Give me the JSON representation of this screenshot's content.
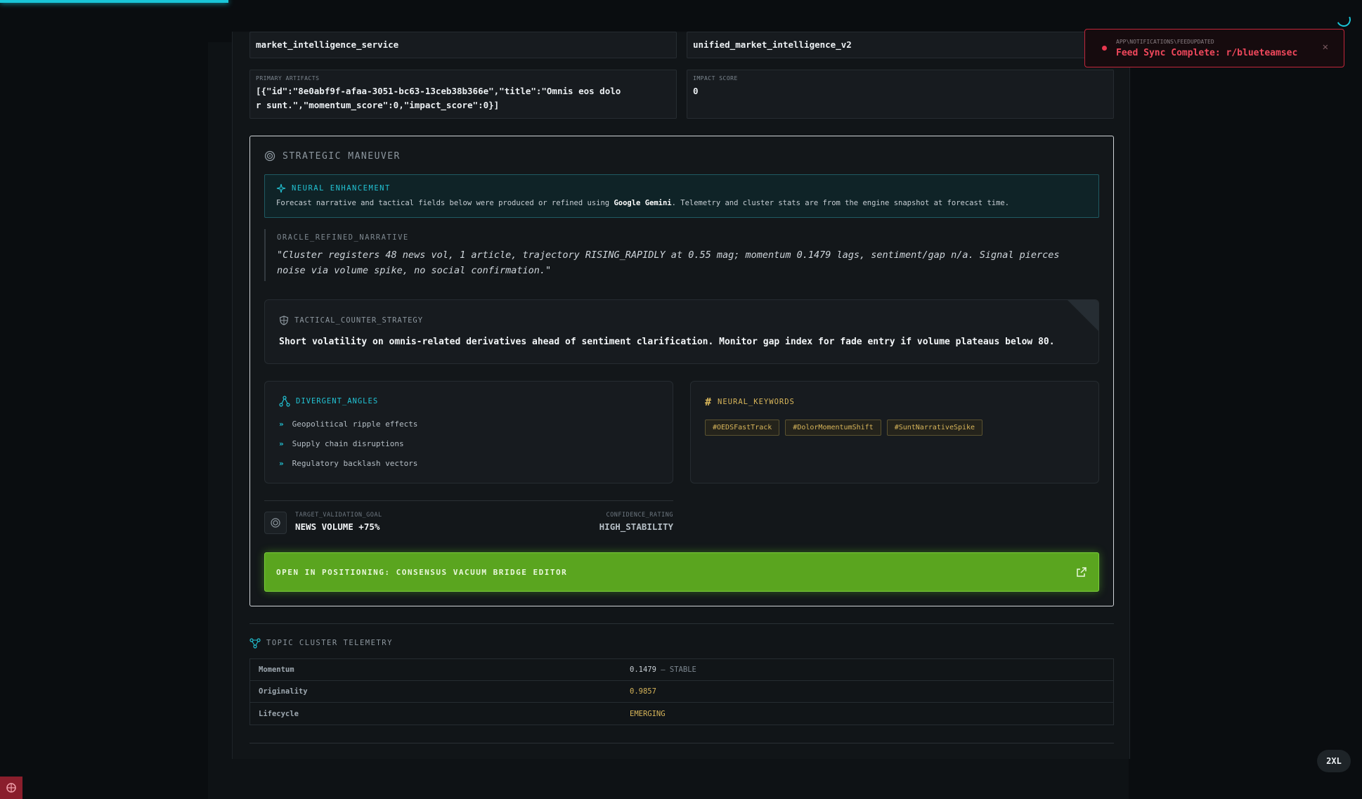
{
  "meta_fields": {
    "service": "market_intelligence_service",
    "model": "unified_market_intelligence_v2",
    "primary_artifacts_label": "PRIMARY ARTIFACTS",
    "primary_artifacts_value": "[{\"id\":\"8e0abf9f-afaa-3051-bc63-13ceb38b366e\",\"title\":\"Omnis eos dolor sunt.\",\"momentum_score\":0,\"impact_score\":0}]",
    "impact_score_label": "IMPACT SCORE",
    "impact_score_value": "0"
  },
  "strategic": {
    "title": "STRATEGIC MANEUVER",
    "neural": {
      "title": "NEURAL ENHANCEMENT",
      "text_before": "Forecast narrative and tactical fields below were produced or refined using ",
      "text_bold": "Google Gemini",
      "text_after": ". Telemetry and cluster stats are from the engine snapshot at forecast time."
    },
    "oracle_label": "ORACLE_REFINED_NARRATIVE",
    "oracle_text": "\"Cluster registers 48 news vol, 1 article, trajectory RISING_RAPIDLY at 0.55 mag; momentum 0.1479 lags, sentiment/gap n/a. Signal pierces noise via volume spike, no social confirmation.\"",
    "tactical_label": "TACTICAL_COUNTER_STRATEGY",
    "tactical_text": "Short volatility on omnis-related derivatives ahead of sentiment clarification. Monitor gap index for fade entry if volume plateaus below 80.",
    "angles_title": "DIVERGENT_ANGLES",
    "angles": [
      "Geopolitical ripple effects",
      "Supply chain disruptions",
      "Regulatory backlash vectors"
    ],
    "keywords_title": "NEURAL_KEYWORDS",
    "keywords": [
      "#OEDSFastTrack",
      "#DolorMomentumShift",
      "#SuntNarrativeSpike"
    ],
    "target_label": "TARGET_VALIDATION_GOAL",
    "target_value": "NEWS VOLUME +75%",
    "confidence_label": "CONFIDENCE_RATING",
    "confidence_value": "HIGH_STABILITY",
    "open_button": "OPEN IN POSITIONING: CONSENSUS VACUUM BRIDGE EDITOR"
  },
  "telemetry": {
    "title": "TOPIC CLUSTER TELEMETRY",
    "rows": [
      {
        "key": "Momentum",
        "value": "0.1479",
        "suffix": " — STABLE"
      },
      {
        "key": "Originality",
        "value": "0.9857",
        "suffix": ""
      },
      {
        "key": "Lifecycle",
        "value": "EMERGING",
        "suffix": ""
      }
    ]
  },
  "toast": {
    "subtitle": "APP\\NOTIFICATIONS\\FEEDUPDATED",
    "message": "Feed Sync Complete: r/blueteamsec",
    "close": "✕"
  },
  "size_badge": "2XL",
  "colors": {
    "accent_cyan": "#22c3d4",
    "accent_gold": "#d7b55a",
    "accent_green": "#5aa51f",
    "alert_red": "#f0485c"
  }
}
